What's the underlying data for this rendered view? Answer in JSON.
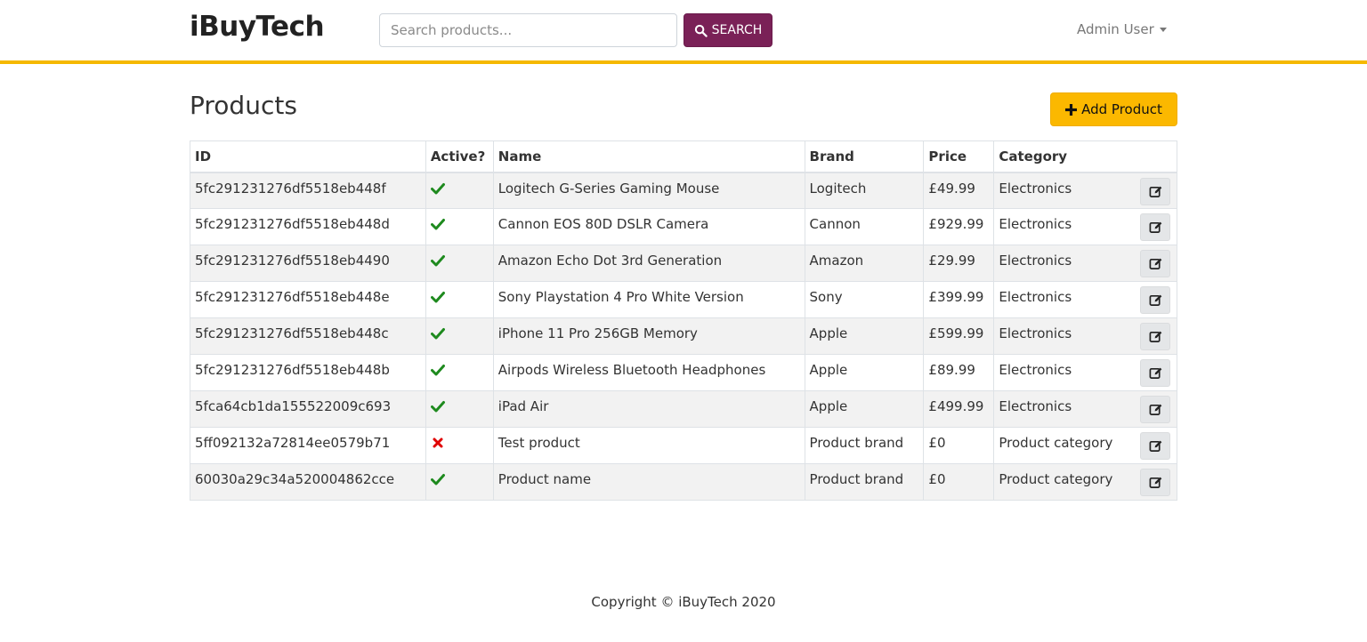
{
  "brand": "iBuyTech",
  "search": {
    "placeholder": "Search products...",
    "button_label": "SEARCH",
    "icon": "search-icon"
  },
  "user_menu": {
    "label": "Admin User",
    "icon": "caret-down-icon"
  },
  "page": {
    "title": "Products",
    "add_button_label": "Add Product",
    "add_icon": "plus-icon"
  },
  "table": {
    "columns": [
      "ID",
      "Active?",
      "Name",
      "Brand",
      "Price",
      "Category"
    ],
    "rows": [
      {
        "id": "5fc291231276df5518eb448f",
        "active": true,
        "name": "Logitech G-Series Gaming Mouse",
        "brand": "Logitech",
        "price": "£49.99",
        "category": "Electronics"
      },
      {
        "id": "5fc291231276df5518eb448d",
        "active": true,
        "name": "Cannon EOS 80D DSLR Camera",
        "brand": "Cannon",
        "price": "£929.99",
        "category": "Electronics"
      },
      {
        "id": "5fc291231276df5518eb4490",
        "active": true,
        "name": "Amazon Echo Dot 3rd Generation",
        "brand": "Amazon",
        "price": "£29.99",
        "category": "Electronics"
      },
      {
        "id": "5fc291231276df5518eb448e",
        "active": true,
        "name": "Sony Playstation 4 Pro White Version",
        "brand": "Sony",
        "price": "£399.99",
        "category": "Electronics"
      },
      {
        "id": "5fc291231276df5518eb448c",
        "active": true,
        "name": "iPhone 11 Pro 256GB Memory",
        "brand": "Apple",
        "price": "£599.99",
        "category": "Electronics"
      },
      {
        "id": "5fc291231276df5518eb448b",
        "active": true,
        "name": "Airpods Wireless Bluetooth Headphones",
        "brand": "Apple",
        "price": "£89.99",
        "category": "Electronics"
      },
      {
        "id": "5fca64cb1da155522009c693",
        "active": true,
        "name": "iPad Air",
        "brand": "Apple",
        "price": "£499.99",
        "category": "Electronics"
      },
      {
        "id": "5ff092132a72814ee0579b71",
        "active": false,
        "name": "Test product",
        "brand": "Product brand",
        "price": "£0",
        "category": "Product category"
      },
      {
        "id": "60030a29c34a520004862cce",
        "active": true,
        "name": "Product name",
        "brand": "Product brand",
        "price": "£0",
        "category": "Product category"
      }
    ],
    "active_icon": "check-icon",
    "inactive_icon": "cross-icon",
    "edit_icon": "edit-icon"
  },
  "colors": {
    "accent": "#f5b800",
    "search_button": "#7a2157",
    "add_button": "#fbb800",
    "active_check": "#1e8a1e",
    "inactive_cross": "#e00000"
  },
  "footer": {
    "text": "Copyright © iBuyTech 2020"
  }
}
